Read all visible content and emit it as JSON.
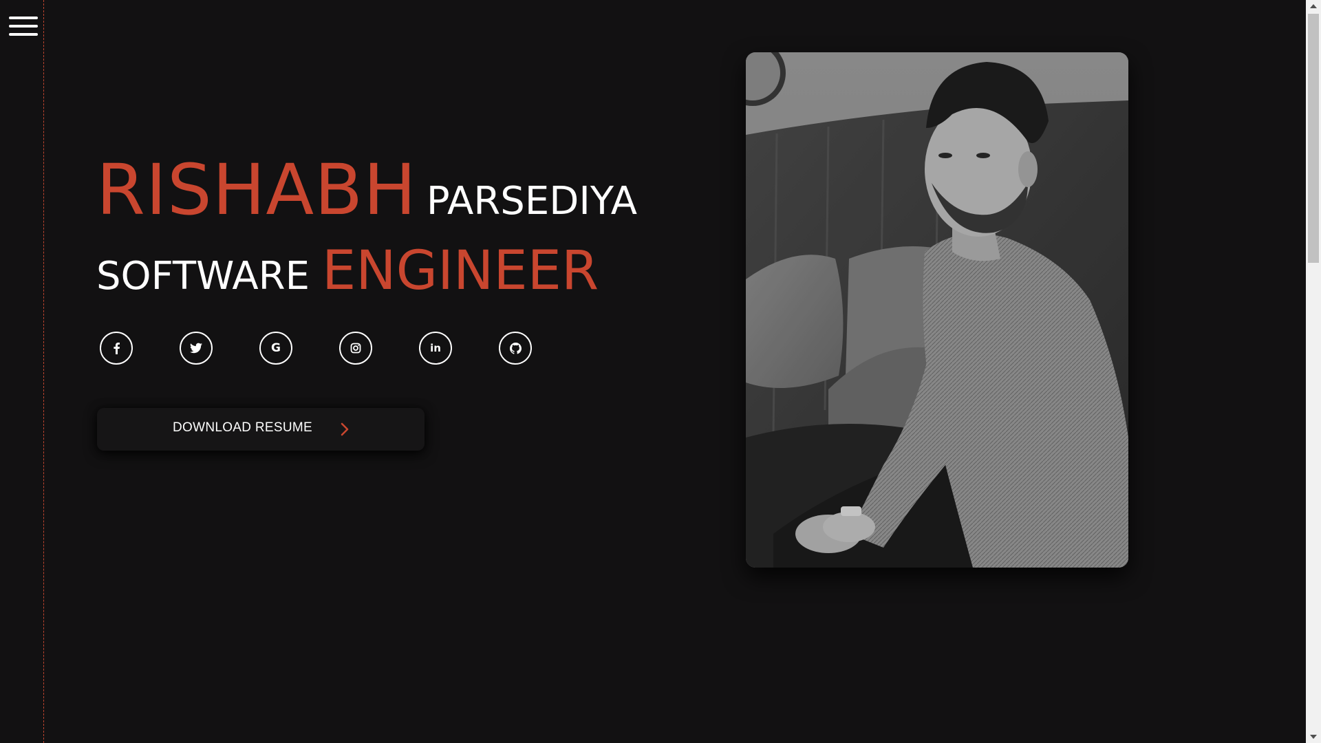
{
  "nav": {
    "menu_icon": "hamburger-menu-icon"
  },
  "hero": {
    "first_name": "RISHABH",
    "last_name": "PARSEDIYA",
    "title_part1": "SOFTWARE",
    "title_part2": "ENGINEER"
  },
  "socials": [
    {
      "name": "facebook",
      "icon": "facebook-icon"
    },
    {
      "name": "twitter",
      "icon": "twitter-icon"
    },
    {
      "name": "google",
      "icon": "google-icon"
    },
    {
      "name": "instagram",
      "icon": "instagram-icon"
    },
    {
      "name": "linkedin",
      "icon": "linkedin-icon"
    },
    {
      "name": "github",
      "icon": "github-icon"
    }
  ],
  "cta": {
    "download_label": "DOWNLOAD RESUME",
    "arrow_icon": "chevron-right-icon"
  },
  "colors": {
    "accent": "#c9462f",
    "background": "#121112",
    "text": "#ffffff"
  }
}
